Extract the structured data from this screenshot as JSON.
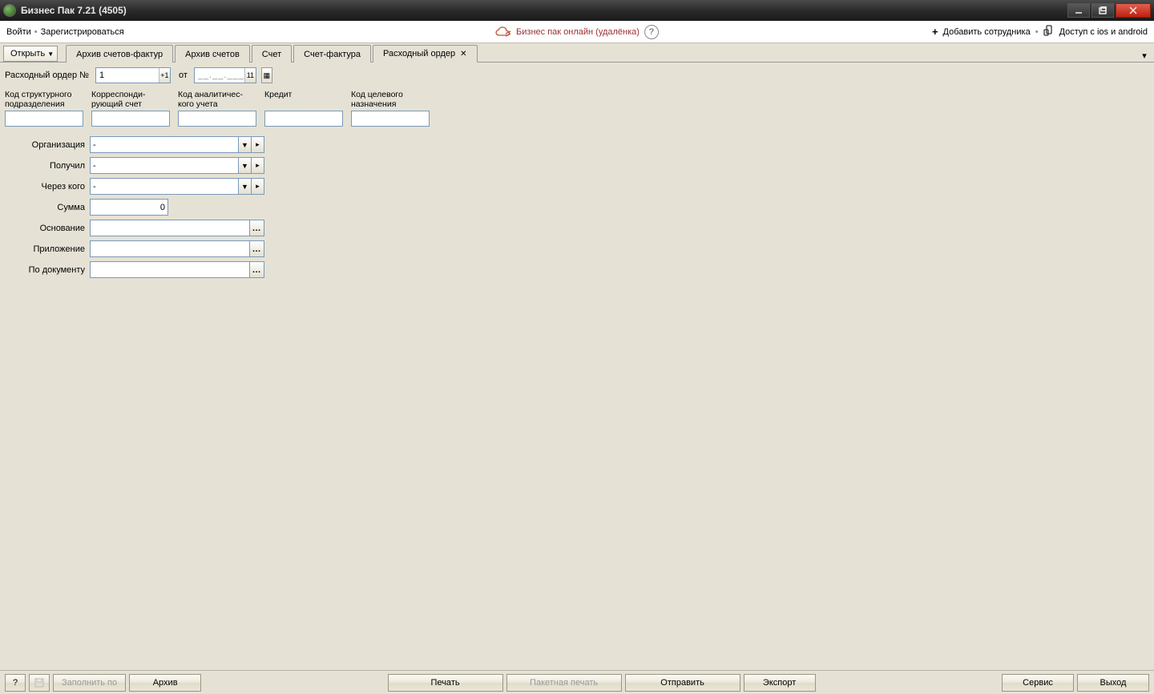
{
  "titlebar": {
    "title": "Бизнес Пак 7.21 (4505)"
  },
  "secbar": {
    "login": "Войти",
    "register": "Зарегистрироваться",
    "online": "Бизнес пак онлайн (удалёнка)",
    "add_employee": "Добавить сотрудника",
    "mobile_access": "Доступ с ios и android"
  },
  "tabs": {
    "open": "Открыть",
    "items": [
      {
        "label": "Архив счетов-фактур"
      },
      {
        "label": "Архив счетов"
      },
      {
        "label": "Счет"
      },
      {
        "label": "Счет-фактура"
      },
      {
        "label": "Расходный ордер",
        "active": true,
        "closable": true
      }
    ]
  },
  "form": {
    "number_label": "Расходный ордер №",
    "number_value": "1",
    "plus1": "+1",
    "from_label": "от",
    "date_value": "__.__.____",
    "day_hint": "11",
    "cols": [
      {
        "label": "Код структурного подразделения"
      },
      {
        "label": "Корреспонди-рующий счет"
      },
      {
        "label": "Код аналитичес-кого учета"
      },
      {
        "label": "Кредит"
      },
      {
        "label": "Код целевого назначения"
      }
    ],
    "org_label": "Организация",
    "org_value": "-",
    "recv_label": "Получил",
    "recv_value": "-",
    "via_label": "Через кого",
    "via_value": "-",
    "sum_label": "Сумма",
    "sum_value": "0",
    "basis_label": "Основание",
    "basis_value": "",
    "attach_label": "Приложение",
    "attach_value": "",
    "bydoc_label": "По документу",
    "bydoc_value": ""
  },
  "bottom": {
    "fill": "Заполнить по",
    "archive": "Архив",
    "print": "Печать",
    "batch_print": "Пакетная печать",
    "send": "Отправить",
    "export": "Экспорт",
    "service": "Сервис",
    "exit": "Выход"
  }
}
